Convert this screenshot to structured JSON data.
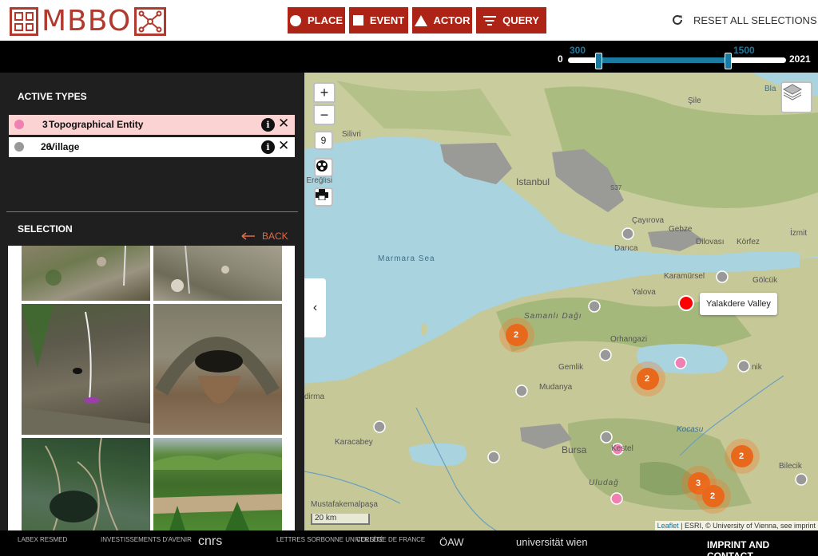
{
  "header": {
    "logo_text": "MBBO",
    "nav": [
      {
        "label": "PLACE",
        "icon": "circle-icon"
      },
      {
        "label": "EVENT",
        "icon": "square-icon"
      },
      {
        "label": "ACTOR",
        "icon": "triangle-icon"
      },
      {
        "label": "QUERY",
        "icon": "filter-icon"
      }
    ],
    "reset_label": "RESET ALL SELECTIONS"
  },
  "timeline": {
    "min": "0",
    "max": "2021",
    "from": "300",
    "to": "1500",
    "accent": "#1a7aa0"
  },
  "sidebar": {
    "active_types_title": "ACTIVE TYPES",
    "types": [
      {
        "count": "3",
        "label": "Topographical Entity",
        "color": "#f07fb2",
        "bg": "#fbd3d3"
      },
      {
        "count": "26",
        "label": "Village",
        "color": "#999999",
        "bg": "#ffffff"
      }
    ],
    "selection_title": "SELECTION",
    "back_label": "BACK"
  },
  "map": {
    "zoom_in": "+",
    "zoom_out": "−",
    "zoom_level": "9",
    "tooltip": "Yalakdere Valley",
    "water_labels": [
      "Marmara Sea"
    ],
    "place_labels": [
      "Şile",
      "Silivri",
      "Istanbul",
      "Çayırova",
      "Gebze",
      "Dilovası",
      "Körfez",
      "İzmit",
      "Darıca",
      "Karamürsel",
      "Gölcük",
      "Yalova",
      "Samanlı Dağı",
      "Orhangazi",
      "Gemlik",
      "Mudanya",
      "Karacabey",
      "Bursa",
      "Kestel",
      "Mustafakemalpaşa",
      "Bilecik",
      "Uludağ",
      "Kocasu",
      "Bla",
      "a Ereğlisi",
      "dirma",
      "nik",
      "S37"
    ],
    "clusters": [
      "2",
      "2",
      "2",
      "3",
      "2"
    ],
    "scale": "20 km",
    "attribution_link": "Leaflet",
    "attribution_text": " | ESRI, © University of Vienna, see imprint"
  },
  "footer": {
    "logos": [
      "LABEX RESMED",
      "INVESTISSEMENTS D'AVENIR",
      "cnrs",
      "LETTRES SORBONNE UNIVERSITÉ",
      "COLLÈGE DE FRANCE",
      "ÖAW",
      "universität wien"
    ],
    "imprint": "IMPRINT AND CONTACT"
  }
}
